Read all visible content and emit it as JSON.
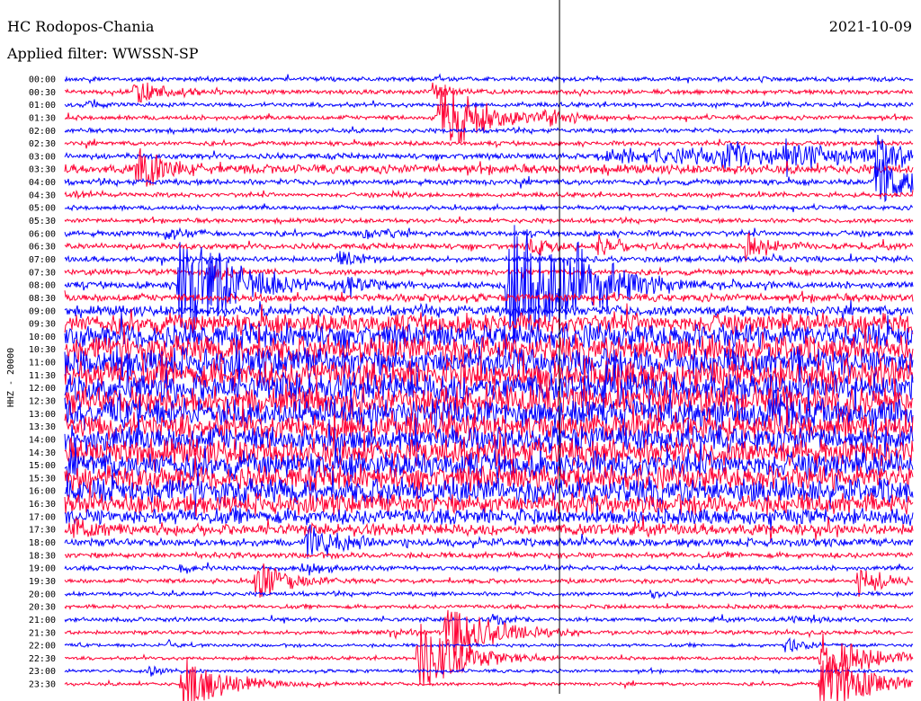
{
  "header": {
    "station": "HC Rodopos-Chania",
    "filter": "Applied filter: WWSSN-SP",
    "date": "2021-10-09"
  },
  "chart_data": {
    "type": "line",
    "title": "HC Rodopos-Chania",
    "ylabel": "HHZ - 20000",
    "xlabel": "",
    "minutes_per_row": 30,
    "series_colors": [
      "#0000ff",
      "#ff0033"
    ],
    "row_labels": [
      "00:00",
      "00:30",
      "01:00",
      "01:30",
      "02:00",
      "02:30",
      "03:00",
      "03:30",
      "04:00",
      "04:30",
      "05:00",
      "05:30",
      "06:00",
      "06:30",
      "07:00",
      "07:30",
      "08:00",
      "08:30",
      "09:00",
      "09:30",
      "10:00",
      "10:30",
      "11:00",
      "11:30",
      "12:00",
      "12:30",
      "13:00",
      "13:30",
      "14:00",
      "14:30",
      "15:00",
      "15:30",
      "16:00",
      "16:30",
      "17:00",
      "17:30",
      "18:00",
      "18:30",
      "19:00",
      "19:30",
      "20:00",
      "20:30",
      "21:00",
      "21:30",
      "22:00",
      "22:30",
      "23:00",
      "23:30"
    ],
    "noise_level": [
      2,
      2,
      2,
      2,
      2,
      2,
      2.5,
      3,
      2.5,
      2,
      2,
      2,
      2.5,
      2.5,
      2.5,
      2.5,
      3,
      3.5,
      4.5,
      9,
      11,
      12,
      13,
      13,
      13,
      13,
      13,
      12,
      12,
      12,
      12,
      11,
      11,
      9,
      7,
      5,
      3.5,
      2.5,
      2,
      2,
      1.8,
      1.8,
      1.8,
      1.8,
      1.5,
      1.5,
      1.5,
      1.5
    ],
    "noise_boost": [
      {
        "row": 6,
        "from_min": 19,
        "level": 7
      },
      {
        "row": 7,
        "from_min": 0,
        "level": 4
      }
    ],
    "events": [
      {
        "row": 1,
        "min": 2.5,
        "amp": 14,
        "dur": 1.2
      },
      {
        "row": 1,
        "min": 13.0,
        "amp": 10,
        "dur": 1.0
      },
      {
        "row": 2,
        "min": 0.8,
        "amp": 5,
        "dur": 0.8
      },
      {
        "row": 3,
        "min": 13.3,
        "amp": 45,
        "dur": 1.5
      },
      {
        "row": 3,
        "min": 17.0,
        "amp": 12,
        "dur": 1.0
      },
      {
        "row": 6,
        "min": 23.3,
        "amp": 20,
        "dur": 1.0
      },
      {
        "row": 6,
        "min": 25.5,
        "amp": 24,
        "dur": 1.0
      },
      {
        "row": 6,
        "min": 28.7,
        "amp": 28,
        "dur": 0.8
      },
      {
        "row": 7,
        "min": 2.6,
        "amp": 25,
        "dur": 1.2
      },
      {
        "row": 8,
        "min": 28.7,
        "amp": 32,
        "dur": 1.2
      },
      {
        "row": 9,
        "min": 0.4,
        "amp": 5,
        "dur": 0.6
      },
      {
        "row": 9,
        "min": 11.5,
        "amp": 5,
        "dur": 0.6
      },
      {
        "row": 12,
        "min": 3.6,
        "amp": 7,
        "dur": 0.8
      },
      {
        "row": 12,
        "min": 10.6,
        "amp": 10,
        "dur": 0.8
      },
      {
        "row": 13,
        "min": 16.5,
        "amp": 14,
        "dur": 0.8
      },
      {
        "row": 13,
        "min": 18.9,
        "amp": 14,
        "dur": 0.8
      },
      {
        "row": 13,
        "min": 24.1,
        "amp": 18,
        "dur": 1.0
      },
      {
        "row": 14,
        "min": 9.7,
        "amp": 10,
        "dur": 0.8
      },
      {
        "row": 15,
        "min": 5.2,
        "amp": 10,
        "dur": 0.8
      },
      {
        "row": 16,
        "min": 9.9,
        "amp": 14,
        "dur": 1.0
      },
      {
        "row": 16,
        "min": 4.1,
        "amp": 80,
        "dur": 1.6
      },
      {
        "row": 16,
        "min": 15.7,
        "amp": 85,
        "dur": 2.0
      },
      {
        "row": 16,
        "min": 17.5,
        "amp": 50,
        "dur": 1.5
      },
      {
        "row": 35,
        "min": 0.3,
        "amp": 16,
        "dur": 1.0
      },
      {
        "row": 36,
        "min": 8.6,
        "amp": 22,
        "dur": 1.2
      },
      {
        "row": 38,
        "min": 4.1,
        "amp": 8,
        "dur": 0.6
      },
      {
        "row": 38,
        "min": 8.4,
        "amp": 10,
        "dur": 0.8
      },
      {
        "row": 39,
        "min": 6.8,
        "amp": 24,
        "dur": 1.2
      },
      {
        "row": 39,
        "min": 28.1,
        "amp": 18,
        "dur": 1.0
      },
      {
        "row": 40,
        "min": 20.8,
        "amp": 5,
        "dur": 0.6
      },
      {
        "row": 42,
        "min": 15.2,
        "amp": 8,
        "dur": 0.8
      },
      {
        "row": 42,
        "min": 25.7,
        "amp": 6,
        "dur": 0.8
      },
      {
        "row": 43,
        "min": 13.5,
        "amp": 40,
        "dur": 1.5
      },
      {
        "row": 43,
        "min": 11.5,
        "amp": 6,
        "dur": 1.0
      },
      {
        "row": 44,
        "min": 25.5,
        "amp": 10,
        "dur": 0.8
      },
      {
        "row": 44,
        "min": 3.7,
        "amp": 6,
        "dur": 0.5
      },
      {
        "row": 45,
        "min": 12.5,
        "amp": 42,
        "dur": 1.5
      },
      {
        "row": 45,
        "min": 26.8,
        "amp": 36,
        "dur": 1.5
      },
      {
        "row": 46,
        "min": 3.0,
        "amp": 7,
        "dur": 0.6
      },
      {
        "row": 47,
        "min": 4.2,
        "amp": 32,
        "dur": 1.5
      },
      {
        "row": 47,
        "min": 26.8,
        "amp": 40,
        "dur": 1.5
      }
    ],
    "marker_min": 17.5
  }
}
